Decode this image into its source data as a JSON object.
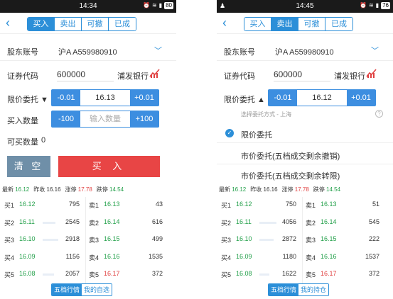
{
  "left": {
    "status": {
      "time": "14:34",
      "battery": "80"
    },
    "tabs": [
      "买入",
      "卖出",
      "可撤",
      "已成"
    ],
    "active_tab": 0,
    "account": {
      "label": "股东账号",
      "value": "沪A A559980910"
    },
    "stock": {
      "label": "证券代码",
      "code": "600000",
      "name": "浦发银行"
    },
    "price": {
      "label": "限价委托 ▼",
      "minus": "-0.01",
      "value": "16.13",
      "plus": "+0.01"
    },
    "quantity": {
      "label": "买入数量",
      "minus": "-100",
      "placeholder": "输入数量",
      "plus": "+100"
    },
    "available": {
      "label": "可买数量",
      "value": "0"
    },
    "buttons": {
      "clear": "清 空",
      "buy": "买 入"
    },
    "quote": {
      "latest_label": "最新",
      "latest": "16.12",
      "prev_label": "昨收",
      "prev": "16.16",
      "up_label": "涨停",
      "up": "17.78",
      "down_label": "跌停",
      "down": "14.54"
    },
    "buys": [
      {
        "label": "买1",
        "price": "16.12",
        "vol": "795"
      },
      {
        "label": "买2",
        "price": "16.11",
        "vol": "2545"
      },
      {
        "label": "买3",
        "price": "16.10",
        "vol": "2918"
      },
      {
        "label": "买4",
        "price": "16.09",
        "vol": "1156"
      },
      {
        "label": "买5",
        "price": "16.08",
        "vol": "2057"
      }
    ],
    "sells": [
      {
        "label": "卖1",
        "price": "16.13",
        "vol": "43"
      },
      {
        "label": "卖2",
        "price": "16.14",
        "vol": "616"
      },
      {
        "label": "卖3",
        "price": "16.15",
        "vol": "499"
      },
      {
        "label": "卖4",
        "price": "16.16",
        "vol": "1535"
      },
      {
        "label": "卖5",
        "price": "16.17",
        "vol": "372"
      }
    ],
    "bottom_tabs": [
      "五档行情",
      "我的自选"
    ]
  },
  "right": {
    "status": {
      "time": "14:45",
      "battery": "76"
    },
    "tabs": [
      "买入",
      "卖出",
      "可撤",
      "已成"
    ],
    "active_tab": 1,
    "account": {
      "label": "股东账号",
      "value": "沪A A559980910"
    },
    "stock": {
      "label": "证券代码",
      "code": "600000",
      "name": "浦发银行"
    },
    "price": {
      "label": "限价委托 ▲",
      "minus": "-0.01",
      "value": "16.12",
      "plus": "+0.01"
    },
    "dropdown": {
      "hint": "选择委托方式 - 上海",
      "options": [
        "限价委托",
        "市价委托(五档成交剩余撤销)",
        "市价委托(五档成交剩余转限)"
      ]
    },
    "quote": {
      "latest_label": "最新",
      "latest": "16.12",
      "prev_label": "昨收",
      "prev": "16.16",
      "up_label": "涨停",
      "up": "17.78",
      "down_label": "跌停",
      "down": "14.54"
    },
    "buys": [
      {
        "label": "买1",
        "price": "16.12",
        "vol": "750"
      },
      {
        "label": "买2",
        "price": "16.11",
        "vol": "4056"
      },
      {
        "label": "买3",
        "price": "16.10",
        "vol": "2872"
      },
      {
        "label": "买4",
        "price": "16.09",
        "vol": "1180"
      },
      {
        "label": "买5",
        "price": "16.08",
        "vol": "1622"
      }
    ],
    "sells": [
      {
        "label": "卖1",
        "price": "16.13",
        "vol": "51"
      },
      {
        "label": "卖2",
        "price": "16.14",
        "vol": "545"
      },
      {
        "label": "卖3",
        "price": "16.15",
        "vol": "222"
      },
      {
        "label": "卖4",
        "price": "16.16",
        "vol": "1537"
      },
      {
        "label": "卖5",
        "price": "16.17",
        "vol": "372"
      }
    ],
    "bottom_tabs": [
      "五档行情",
      "我的持仓"
    ]
  }
}
